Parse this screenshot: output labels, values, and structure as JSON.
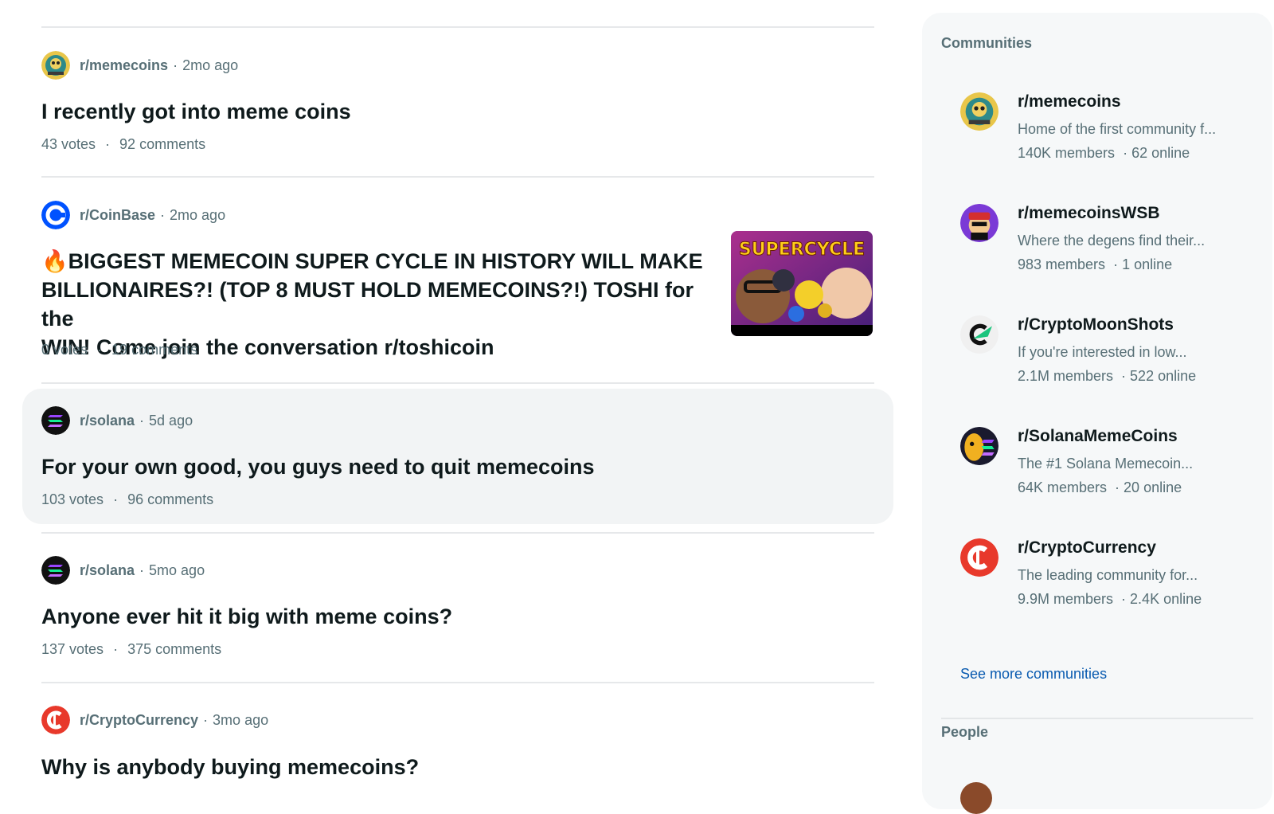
{
  "posts": [
    {
      "subreddit": "r/memecoins",
      "time": "2mo ago",
      "title": "I recently got into meme coins",
      "votes": "43 votes",
      "comments": "92 comments",
      "avatar_icon": "memecoins-avatar-icon"
    },
    {
      "subreddit": "r/CoinBase",
      "time": "2mo ago",
      "title_line1": "🔥BIGGEST MEMECOIN SUPER CYCLE IN HISTORY WILL MAKE",
      "title_line2": "BILLIONAIRES?! (TOP 8 MUST HOLD MEMECOINS?!) TOSHI for the",
      "title_line3": "WIN! Come join the conversation r/toshicoin",
      "votes": "0 votes",
      "comments": "19 comments",
      "thumbnail_text": "SUPERCYCLE",
      "avatar_icon": "coinbase-avatar-icon"
    },
    {
      "subreddit": "r/solana",
      "time": "5d ago",
      "title": "For your own good, you guys need to quit memecoins",
      "votes": "103 votes",
      "comments": "96 comments",
      "avatar_icon": "solana-avatar-icon"
    },
    {
      "subreddit": "r/solana",
      "time": "5mo ago",
      "title": "Anyone ever hit it big with meme coins?",
      "votes": "137 votes",
      "comments": "375 comments",
      "avatar_icon": "solana-avatar-icon"
    },
    {
      "subreddit": "r/CryptoCurrency",
      "time": "3mo ago",
      "title": "Why is anybody buying memecoins?",
      "avatar_icon": "cryptocurrency-avatar-icon"
    }
  ],
  "sidebar": {
    "communities_heading": "Communities",
    "communities": [
      {
        "name": "r/memecoins",
        "desc": "Home of the first community f...",
        "members": "140K members",
        "online": "62 online"
      },
      {
        "name": "r/memecoinsWSB",
        "desc": "Where the degens find their...",
        "members": "983 members",
        "online": "1 online"
      },
      {
        "name": "r/CryptoMoonShots",
        "desc": "If you're interested in low...",
        "members": "2.1M members",
        "online": "522 online"
      },
      {
        "name": "r/SolanaMemeCoins",
        "desc": "The #1 Solana Memecoin...",
        "members": "64K members",
        "online": "20 online"
      },
      {
        "name": "r/CryptoCurrency",
        "desc": "The leading community for...",
        "members": "9.9M members",
        "online": "2.4K online"
      }
    ],
    "see_more": "See more communities",
    "people_heading": "People"
  },
  "colors": {
    "meta_text": "#576f76",
    "link": "#0a5bb0",
    "hover_bg": "#f2f4f5",
    "sidebar_bg": "#f6f8f9"
  }
}
